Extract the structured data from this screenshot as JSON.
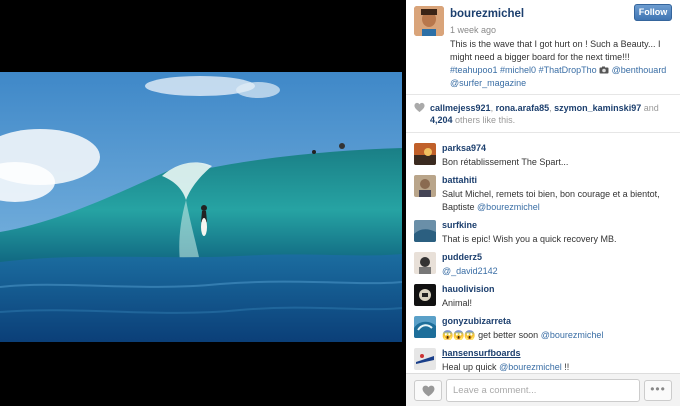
{
  "post": {
    "username": "bourezmichel",
    "time": "1 week ago",
    "follow_label": "Follow",
    "caption_text": "This is the wave that I got hurt on ! Such a Beauty... I might need a bigger board for the next time!!!",
    "caption_tags": "#teahupoo1 #michel0 #ThatDropTho",
    "caption_icon": "camera-emoji",
    "caption_mentions": "@benthouard @surfer_magazine"
  },
  "likes": {
    "users": [
      "callmejess921",
      "rona.arafa85",
      "szymon_kaminski97"
    ],
    "separator": ",",
    "and_text": "and",
    "others_count": "4,204",
    "others_text": "others like this."
  },
  "comments": [
    {
      "user": "parksa974",
      "text": "Bon rétablissement The Spart...",
      "mention": ""
    },
    {
      "user": "battahiti",
      "text": "Salut Michel, remets toi bien, bon courage et a bientot, Baptiste",
      "mention": "@bourezmichel"
    },
    {
      "user": "surfkine",
      "text": "That is epic! Wish you a quick recovery MB.",
      "mention": ""
    },
    {
      "user": "pudderz5",
      "text": "",
      "mention": "@_david2142"
    },
    {
      "user": "hauolivision",
      "text": "Animal!",
      "mention": ""
    },
    {
      "user": "gonyzubizarreta",
      "text": "😱😱😱 get better soon",
      "mention": "@bourezmichel"
    },
    {
      "user": "hansensurfboards",
      "text": "Heal up quick",
      "mention": "@bourezmichel",
      "suffix": "!!"
    }
  ],
  "footer": {
    "comment_placeholder": "Leave a comment...",
    "more_label": "•••"
  },
  "colors": {
    "username": "#1c3f6e",
    "tag": "#3a6ea5",
    "follow": "#3f75b3"
  }
}
